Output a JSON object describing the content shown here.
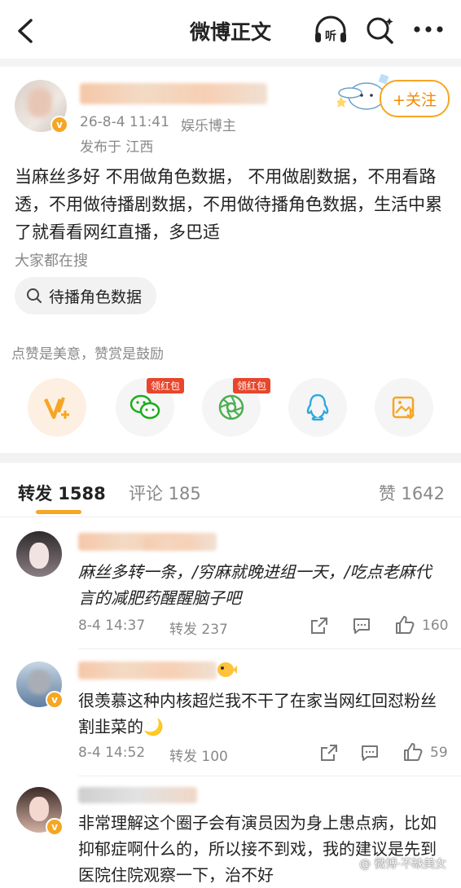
{
  "header": {
    "title": "微博正文"
  },
  "post": {
    "date": "26-8-4 11:41",
    "author_tag": "娱乐博主",
    "location": "发布于 江西",
    "follow_label": "+关注",
    "text": "当麻丝多好 不用做角色数据， 不用做剧数据，不用看路透，不用做待播剧数据，不用做待播角色数据，生活中累了就看看网红直播，多巴适",
    "search_heading": "大家都在搜",
    "search_chip": "待播角色数据",
    "tip_text": "点赞是美意，赞赏是鼓励"
  },
  "share": {
    "red_packet_label": "领红包",
    "items": [
      {
        "icon": "v-plus-icon",
        "color": "#f5a623"
      },
      {
        "icon": "wechat-icon",
        "color": "#1aad19"
      },
      {
        "icon": "moments-icon",
        "color": "#4caf50"
      },
      {
        "icon": "qq-icon",
        "color": "#2aa9e0"
      },
      {
        "icon": "save-image-icon",
        "color": "#f5a623"
      }
    ]
  },
  "tabs": {
    "repost": "转发 1588",
    "comment": "评论 185",
    "like": "赞 1642"
  },
  "comments": [
    {
      "text": "麻丝多转一条，/穷麻就晚进组一天，/吃点老麻代言的减肥药醒醒脑子吧",
      "time": "8-4 14:37",
      "repost": "转发 237",
      "likes": "160"
    },
    {
      "text": "很羡慕这种内核超烂我不干了在家当网红回怼粉丝割韭菜的🌙",
      "time": "8-4 14:52",
      "repost": "转发 100",
      "likes": "59"
    },
    {
      "text": "非常理解这个圈子会有演员因为身上患点病，比如抑郁症啊什么的，所以接不到戏，我的建议是先到医院住院观察一下，治不好"
    }
  ],
  "watermark": "@ 微博·不缺美女"
}
